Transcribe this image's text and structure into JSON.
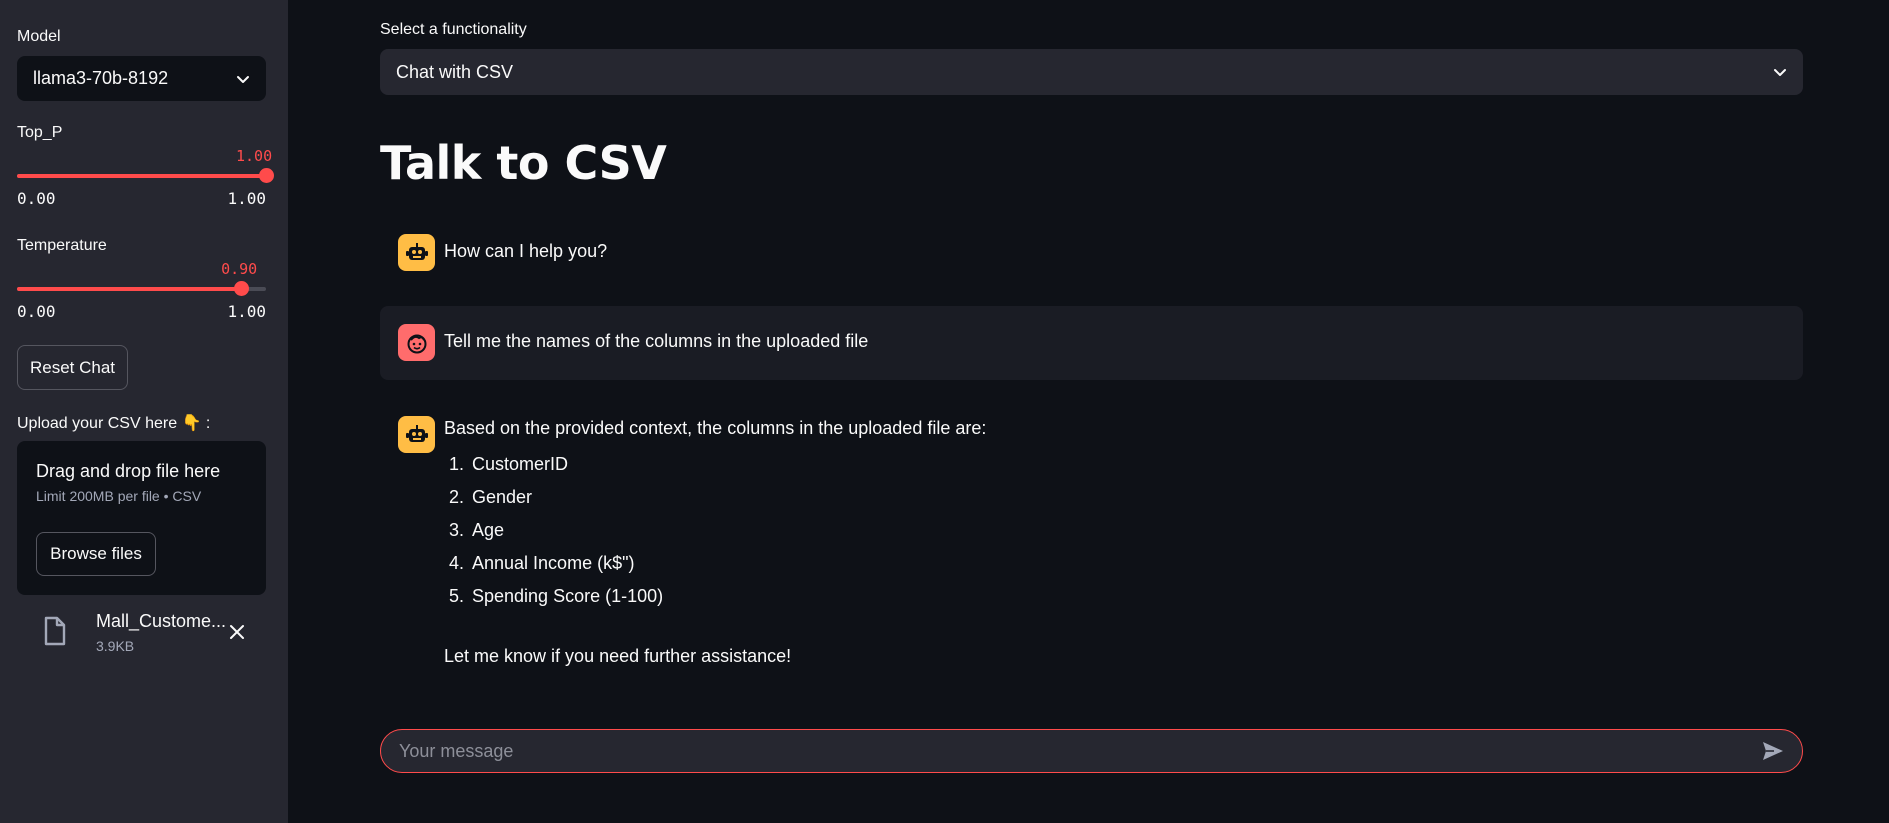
{
  "sidebar": {
    "model_label": "Model",
    "model_value": "llama3-70b-8192",
    "top_p": {
      "label": "Top_P",
      "value": "1.00",
      "min": "0.00",
      "max": "1.00",
      "fraction": 1.0
    },
    "temperature": {
      "label": "Temperature",
      "value": "0.90",
      "min": "0.00",
      "max": "1.00",
      "fraction": 0.9
    },
    "reset_button": "Reset Chat",
    "upload_label": "Upload your CSV here 👇 :",
    "dropzone": {
      "title": "Drag and drop file here",
      "limit": "Limit 200MB per file • CSV",
      "browse_button": "Browse files"
    },
    "file": {
      "name": "Mall_Custome...",
      "size": "3.9KB"
    }
  },
  "main": {
    "func_label": "Select a functionality",
    "func_value": "Chat with CSV",
    "title": "Talk to CSV",
    "messages": [
      {
        "role": "assistant",
        "text": "How can I help you?"
      },
      {
        "role": "user",
        "text": "Tell me the names of the columns in the uploaded file"
      },
      {
        "role": "assistant",
        "intro": "Based on the provided context, the columns in the uploaded file are:",
        "items": [
          {
            "num": "1.",
            "text": "CustomerID"
          },
          {
            "num": "2.",
            "text": "Gender"
          },
          {
            "num": "3.",
            "text": "Age"
          },
          {
            "num": "4.",
            "text": "Annual Income (k$\")"
          },
          {
            "num": "5.",
            "text": "Spending Score (1-100)"
          }
        ],
        "outro": "Let me know if you need further assistance!"
      }
    ],
    "chat_input_placeholder": "Your message"
  },
  "colors": {
    "accent": "#ff4b4b",
    "sidebar_bg": "#262730",
    "main_bg": "#0e1117",
    "bot_avatar": "#ffbd45",
    "user_avatar": "#ff6c6c"
  }
}
